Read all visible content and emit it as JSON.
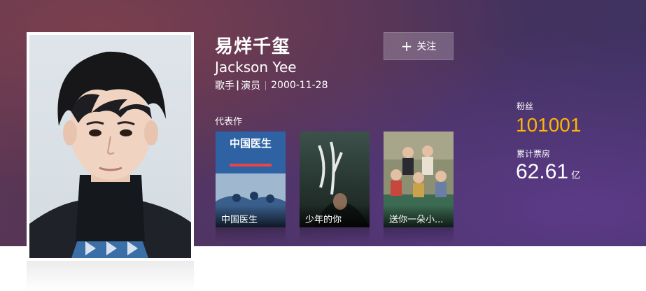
{
  "profile": {
    "name_cn": "易烊千玺",
    "name_en": "Jackson Yee",
    "roles": [
      "歌手",
      "演员"
    ],
    "role_separator": "|",
    "birth_date": "2000-11-28"
  },
  "follow_button": {
    "icon": "plus-icon",
    "label": "关注"
  },
  "works": {
    "label": "代表作",
    "items": [
      {
        "title": "中国医生",
        "poster_text": "中国医生",
        "poster_color": "#3c6ea8"
      },
      {
        "title": "少年的你",
        "poster_color": "#2c3d3a"
      },
      {
        "title": "送你一朵小...",
        "poster_color": "#7a5a3c"
      }
    ]
  },
  "stats": {
    "fans_label": "粉丝",
    "fans_value": "101001",
    "box_office_label": "累计票房",
    "box_office_value": "62.61",
    "box_office_unit": "亿"
  },
  "colors": {
    "accent": "#ffb400",
    "banner": "#4a325c"
  }
}
